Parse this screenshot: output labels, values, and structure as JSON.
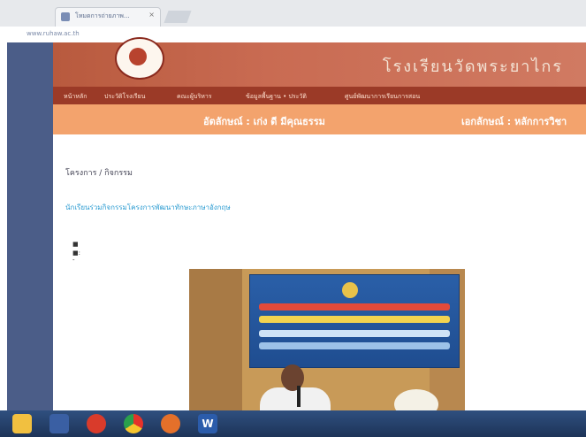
{
  "browser": {
    "tab_title": "โหมดการถ่ายภาพ...",
    "tab_close": "×",
    "address": "www.ruhaw.ac.th"
  },
  "header": {
    "banner_title": "โรงเรียนวัดพระยาไกร",
    "nav": [
      "หน้าหลัก",
      "ประวัติโรงเรียน",
      "คณะผู้บริหาร",
      "ข้อมูลพื้นฐาน • ประวัติ",
      "ศูนย์พัฒนาการเรียนการสอน"
    ],
    "ticker_left": "อัตลักษณ์ : เก่ง ดี มีคุณธรรม",
    "ticker_right": "เอกลักษณ์ : หลักการวิชา"
  },
  "content": {
    "breadcrumb": "โครงการ / กิจกรรม",
    "article_title": "นักเรียนร่วมกิจกรรมโครงการพัฒนาทักษะภาษาอังกฤษ",
    "meta_author_icon": "person-icon",
    "meta_date_icon": "calendar-icon",
    "meta_date": ": -"
  },
  "taskbar": {
    "icons": [
      "explorer-icon",
      "media-icon",
      "opera-icon",
      "chrome-icon",
      "firefox-icon",
      "word-icon"
    ],
    "word_label": "W"
  },
  "colors": {
    "banner": "#c96b52",
    "navbar": "#9b3a27",
    "ticker": "#f3a36d",
    "frame": "#4b5d88",
    "link": "#2a9bd1"
  }
}
